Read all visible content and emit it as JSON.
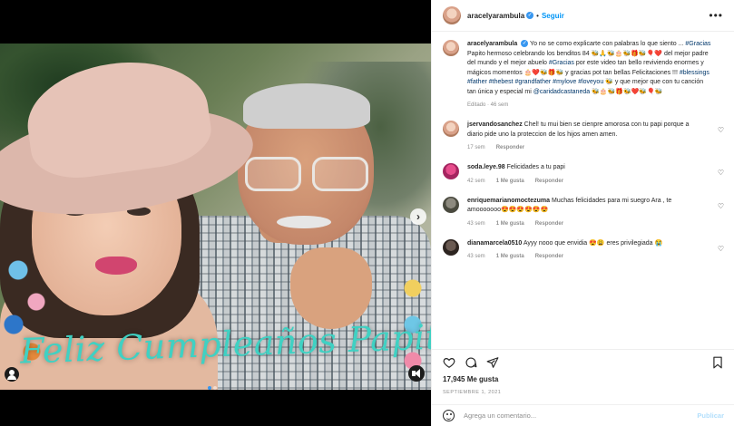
{
  "header": {
    "username": "aracelyarambula",
    "separator": "•",
    "follow_label": "Seguir",
    "more_label": "•••"
  },
  "media": {
    "overlay_text": "Feliz Cumpleaños Papito",
    "next_label": "›",
    "carousel_slides": 2,
    "carousel_active": 1
  },
  "caption": {
    "username": "aracelyarambula",
    "text_1": "Yo no se como explicarte con palabras lo que siento ... ",
    "tag_1": "#Gracias",
    "text_2": " Papito hermoso celebrando los benditos 84 🐝🙏🐝🎂🐝🎁🐝🎈❤️ del mejor padre del mundo y el mejor abuelo ",
    "tag_2": "#Gracias",
    "text_3": " por este video tan bello reviviendo enormes y mágicos momentos 🎂❤️🐝🎁🐝 y gracias pot tan bellas Felicitaciones !!! ",
    "tag_3": "#blessings #father #thebest #grandfather #mylove #loveyou",
    "text_4": " 🐝 y que mejor que con tu canción tan única y especial mi ",
    "tag_4": "@caridadcastaneda",
    "text_5": " 🐝🎂🐝🎁🐝❤️🐝🎈🐝",
    "meta": "Editado · 46 sem"
  },
  "comments": [
    {
      "username": "jservandosanchez",
      "text": "Chel! tu mui bien se cienpre amorosa con tu papi porque a diario pide uno la proteccion de los hijos amen amen.",
      "time": "17 sem",
      "likes": "",
      "reply_label": "Responder"
    },
    {
      "username": "soda.leye.98",
      "text": "Felicidades a tu papi",
      "time": "42 sem",
      "likes": "1 Me gusta",
      "reply_label": "Responder"
    },
    {
      "username": "enriquemarianomoctezuma",
      "text": "Muchas felicidades para mi suegro Ara , te amooooooo😍😍😍😍😍😍",
      "time": "43 sem",
      "likes": "1 Me gusta",
      "reply_label": "Responder"
    },
    {
      "username": "dianamarcela0510",
      "text": "Ayyy nooo que envidia 😍😩 eres privilegiada 😭",
      "time": "43 sem",
      "likes": "1 Me gusta",
      "reply_label": "Responder"
    }
  ],
  "actions": {
    "like_icon": "heart-outline-icon",
    "comment_icon": "comment-icon",
    "share_icon": "share-icon",
    "save_icon": "bookmark-icon"
  },
  "likes_text": "17,945 Me gusta",
  "date_text": "SEPTIEMBRE 1, 2021",
  "add_comment": {
    "placeholder": "Agrega un comentario...",
    "publish_label": "Publicar"
  },
  "colors": {
    "link_blue": "#0095f6",
    "publish_disabled": "#b2dffc",
    "hashtag": "#00376b",
    "overlay_text": "#3fd1c3"
  }
}
